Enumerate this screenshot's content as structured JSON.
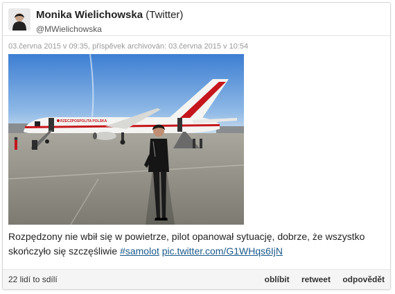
{
  "author": {
    "name": "Monika Wielichowska",
    "source": "(Twitter)",
    "handle": "@MWielichowska"
  },
  "meta": "03.června 2015 v 09:35, příspěvek archivován: 03.června 2015 v 10:54",
  "photo": {
    "airline_lettering": "RZECZPOSPOLITA POLSKA"
  },
  "tweet": {
    "text": "Rozpędzony nie wbił się w powietrze, pilot opanował sytuację, dobrze, że wszystko skończyło się szczęśliwie ",
    "hashtag": "#samolot",
    "link": "pic.twitter.com/G1WHqs6IjN"
  },
  "footer": {
    "shares": "22 lidí to sdílí",
    "like": "oblíbit",
    "retweet": "retweet",
    "reply": "odpovědět"
  },
  "colors": {
    "link": "#1a5a8a",
    "meta": "#999999",
    "footer_bg": "#f5f5f5"
  }
}
